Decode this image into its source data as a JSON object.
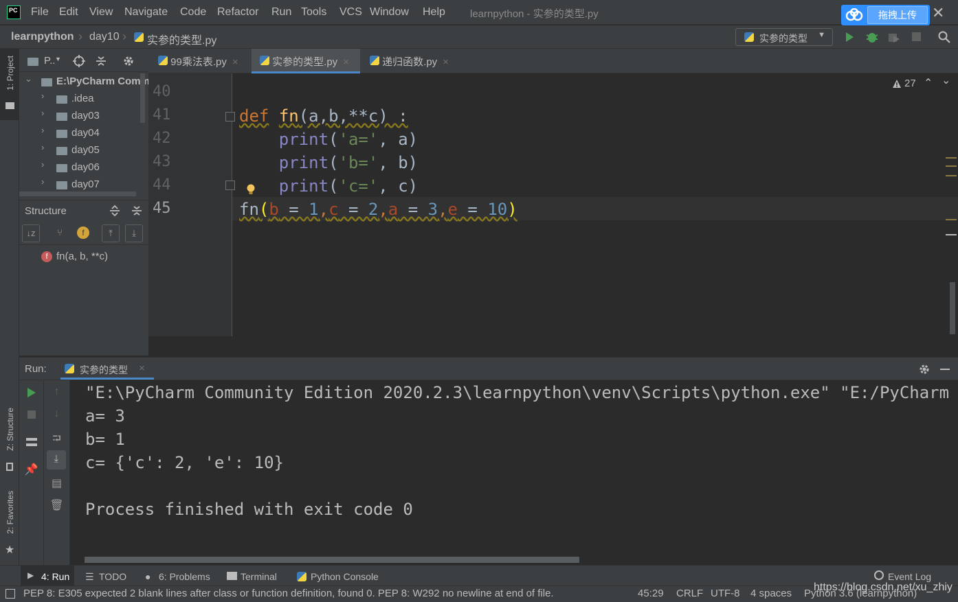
{
  "app": {
    "logo": "PC",
    "menu": [
      "File",
      "Edit",
      "View",
      "Navigate",
      "Code",
      "Refactor",
      "Run",
      "Tools",
      "VCS",
      "Window",
      "Help"
    ],
    "window_title": "learnpython - 实参的类型.py",
    "upload_label": "拖拽上传"
  },
  "navbar": {
    "crumbs": [
      "learnpython",
      "day10",
      "实参的类型.py"
    ],
    "run_config": "实参的类型"
  },
  "left_tool_tabs": [
    "1: Project",
    "Z: Structure",
    "2: Favorites"
  ],
  "project": {
    "header": "P..",
    "root": "E:\\PyCharm Comm",
    "items": [
      ".idea",
      "day03",
      "day04",
      "day05",
      "day06",
      "day07"
    ]
  },
  "structure": {
    "title": "Structure",
    "member_badge": "f",
    "member": "fn(a, b, **c)"
  },
  "editor": {
    "tabs": [
      "99乘法表.py",
      "实参的类型.py",
      "递归函数.py"
    ],
    "active_tab": 1,
    "warnings": "27",
    "line_numbers": [
      "40",
      "41",
      "42",
      "43",
      "44",
      "45"
    ],
    "lines": {
      "l41": {
        "kw": "def",
        "fn": "fn",
        "args": "(a,b,**c) :"
      },
      "l42": {
        "call": "print",
        "str": "'a='",
        "rest": ", a)"
      },
      "l43": {
        "call": "print",
        "str": "'b='",
        "rest": ", b)"
      },
      "l44": {
        "call": "print",
        "str": "'c='",
        "rest": ", c)"
      },
      "l45": {
        "fn": "fn",
        "open": "(",
        "b": "b",
        "eq1": " = ",
        "v1": "1",
        "c": "c",
        "eq2": " = ",
        "v2": "2",
        "a": "a",
        "eq3": " = ",
        "v3": "3",
        "e": "e",
        "eq4": " = ",
        "v4": "10",
        "close": ")"
      }
    }
  },
  "run": {
    "label": "Run:",
    "tab": "实参的类型",
    "console": [
      "\"E:\\PyCharm Community Edition 2020.2.3\\learnpython\\venv\\Scripts\\python.exe\" \"E:/PyCharm",
      "a= 3",
      "b= 1",
      "c= {'c': 2, 'e': 10}",
      "",
      "Process finished with exit code 0"
    ]
  },
  "bottom_tabs": {
    "run": "4: Run",
    "todo": "TODO",
    "problems": "6: Problems",
    "terminal": "Terminal",
    "python_console": "Python Console",
    "event_log": "Event Log"
  },
  "status": {
    "message": "PEP 8: E305 expected 2 blank lines after class or function definition, found 0. PEP 8: W292 no newline at end of file.",
    "position": "45:29",
    "line_sep": "CRLF",
    "encoding": "UTF-8",
    "indent": "4 spaces",
    "interpreter": "Python 3.6 (learnpython)"
  },
  "watermark": "https://blog.csdn.net/xu_zhiy",
  "colors": {
    "keyword": "#cc7832",
    "function": "#ffc66d",
    "string": "#6a8759",
    "number": "#6897bb",
    "param": "#aa4926",
    "builtin": "#8888c6",
    "accent": "#4a88c7"
  }
}
